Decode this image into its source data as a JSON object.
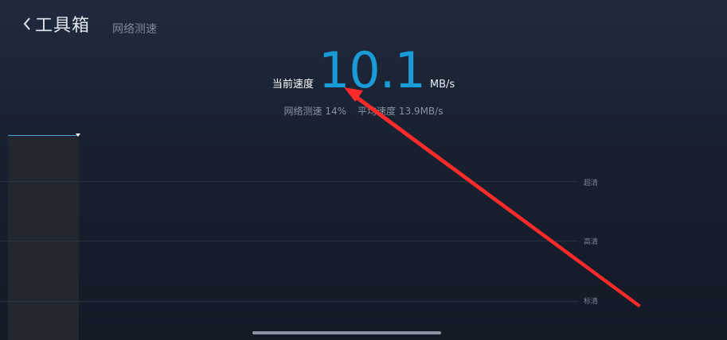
{
  "header": {
    "title": "工具箱",
    "subtitle": "网络测速"
  },
  "speed": {
    "label": "当前速度",
    "value": "10.1",
    "unit": "MB/s"
  },
  "stats": {
    "progress": "网络测速 14%",
    "average": "平均速度 13.9MB/s"
  },
  "quality_levels": {
    "ultra": "超清",
    "high": "高清",
    "standard": "标清"
  },
  "colors": {
    "accent": "#1a9ad6",
    "annotation_arrow": "#ff2a2a"
  }
}
